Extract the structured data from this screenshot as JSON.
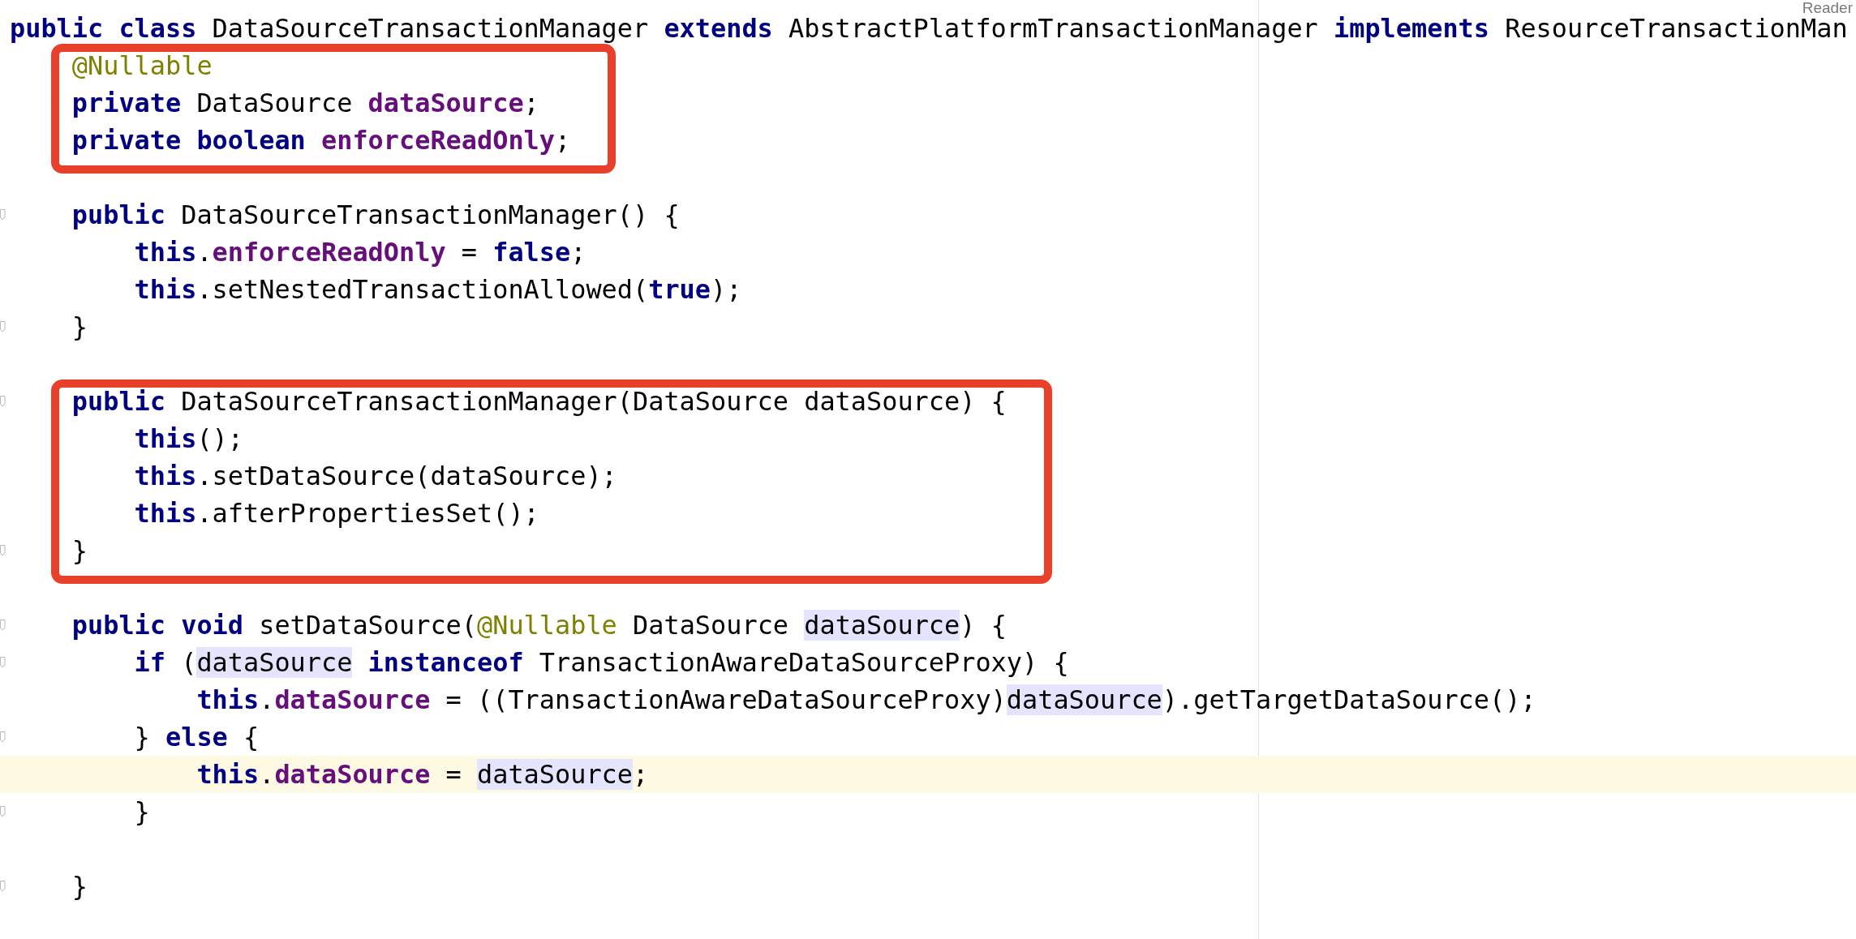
{
  "reader_label": "Reader",
  "blocks": [
    {
      "boxed": false,
      "lines": [
        {
          "current": false,
          "fold_marker": false,
          "tokens": [
            {
              "kind": "keyword",
              "text": "public ",
              "usage": false
            },
            {
              "kind": "keyword",
              "text": "class",
              "usage": false
            },
            {
              "kind": "plain",
              "text": " DataSourceTransactionManager ",
              "usage": false
            },
            {
              "kind": "keyword",
              "text": "extends",
              "usage": false
            },
            {
              "kind": "plain",
              "text": " AbstractPlatformTransactionManager ",
              "usage": false
            },
            {
              "kind": "keyword",
              "text": "implements",
              "usage": false
            },
            {
              "kind": "plain",
              "text": " ResourceTransactionMan",
              "usage": false
            }
          ]
        }
      ]
    },
    {
      "boxed": true,
      "lines": [
        {
          "current": false,
          "fold_marker": false,
          "tokens": [
            {
              "kind": "annotation",
              "text": "    @Nullable",
              "usage": false
            }
          ]
        },
        {
          "current": false,
          "fold_marker": false,
          "tokens": [
            {
              "kind": "keyword",
              "text": "    private",
              "usage": false
            },
            {
              "kind": "plain",
              "text": " DataSource ",
              "usage": false
            },
            {
              "kind": "field",
              "text": "dataSource",
              "usage": false
            },
            {
              "kind": "plain",
              "text": ";",
              "usage": false
            }
          ]
        },
        {
          "current": false,
          "fold_marker": false,
          "tokens": [
            {
              "kind": "keyword",
              "text": "    private ",
              "usage": false
            },
            {
              "kind": "keyword",
              "text": "boolean ",
              "usage": false
            },
            {
              "kind": "field",
              "text": "enforceReadOnly",
              "usage": false
            },
            {
              "kind": "plain",
              "text": ";",
              "usage": false
            }
          ]
        }
      ]
    },
    {
      "boxed": false,
      "lines": [
        {
          "current": false,
          "fold_marker": false
        },
        {
          "current": false,
          "fold_marker": true,
          "tokens": [
            {
              "kind": "keyword",
              "text": "    public",
              "usage": false
            },
            {
              "kind": "plain",
              "text": " DataSourceTransactionManager() {",
              "usage": false
            }
          ]
        },
        {
          "current": false,
          "fold_marker": false,
          "tokens": [
            {
              "kind": "keyword",
              "text": "        this",
              "usage": false
            },
            {
              "kind": "plain",
              "text": ".",
              "usage": false
            },
            {
              "kind": "field",
              "text": "enforceReadOnly",
              "usage": false
            },
            {
              "kind": "plain",
              "text": " = ",
              "usage": false
            },
            {
              "kind": "keyword",
              "text": "false",
              "usage": false
            },
            {
              "kind": "plain",
              "text": ";",
              "usage": false
            }
          ]
        },
        {
          "current": false,
          "fold_marker": false,
          "tokens": [
            {
              "kind": "keyword",
              "text": "        this",
              "usage": false
            },
            {
              "kind": "plain",
              "text": ".setNestedTransactionAllowed(",
              "usage": false
            },
            {
              "kind": "keyword",
              "text": "true",
              "usage": false
            },
            {
              "kind": "plain",
              "text": ");",
              "usage": false
            }
          ]
        },
        {
          "current": false,
          "fold_marker": true,
          "tokens": [
            {
              "kind": "plain",
              "text": "    }",
              "usage": false
            }
          ]
        },
        {
          "current": false,
          "fold_marker": false
        }
      ]
    },
    {
      "boxed": true,
      "lines": [
        {
          "current": false,
          "fold_marker": true,
          "tokens": [
            {
              "kind": "keyword",
              "text": "    public",
              "usage": false
            },
            {
              "kind": "plain",
              "text": " DataSourceTransactionManager(DataSource dataSource) {",
              "usage": false
            }
          ]
        },
        {
          "current": false,
          "fold_marker": false,
          "tokens": [
            {
              "kind": "keyword",
              "text": "        this",
              "usage": false
            },
            {
              "kind": "plain",
              "text": "();",
              "usage": false
            }
          ]
        },
        {
          "current": false,
          "fold_marker": false,
          "tokens": [
            {
              "kind": "keyword",
              "text": "        this",
              "usage": false
            },
            {
              "kind": "plain",
              "text": ".setDataSource(dataSource);",
              "usage": false
            }
          ]
        },
        {
          "current": false,
          "fold_marker": false,
          "tokens": [
            {
              "kind": "keyword",
              "text": "        this",
              "usage": false
            },
            {
              "kind": "plain",
              "text": ".afterPropertiesSet();",
              "usage": false
            }
          ]
        },
        {
          "current": false,
          "fold_marker": true,
          "tokens": [
            {
              "kind": "plain",
              "text": "    }",
              "usage": false
            }
          ]
        }
      ]
    },
    {
      "boxed": false,
      "lines": [
        {
          "current": false,
          "fold_marker": false
        },
        {
          "current": false,
          "fold_marker": true,
          "tokens": [
            {
              "kind": "keyword",
              "text": "    public ",
              "usage": false
            },
            {
              "kind": "keyword",
              "text": "void",
              "usage": false
            },
            {
              "kind": "plain",
              "text": " setDataSource(",
              "usage": false
            },
            {
              "kind": "annotation",
              "text": "@Nullable",
              "usage": false
            },
            {
              "kind": "plain",
              "text": " DataSource ",
              "usage": false
            },
            {
              "kind": "plain",
              "text": "dataSource",
              "usage": true
            },
            {
              "kind": "plain",
              "text": ") {",
              "usage": false
            }
          ]
        },
        {
          "current": false,
          "fold_marker": true,
          "tokens": [
            {
              "kind": "keyword",
              "text": "        if",
              "usage": false
            },
            {
              "kind": "plain",
              "text": " (",
              "usage": false
            },
            {
              "kind": "plain",
              "text": "dataSource",
              "usage": true
            },
            {
              "kind": "keyword",
              "text": " instanceof",
              "usage": false
            },
            {
              "kind": "plain",
              "text": " TransactionAwareDataSourceProxy) {",
              "usage": false
            }
          ]
        },
        {
          "current": false,
          "fold_marker": false,
          "tokens": [
            {
              "kind": "keyword",
              "text": "            this",
              "usage": false
            },
            {
              "kind": "plain",
              "text": ".",
              "usage": false
            },
            {
              "kind": "field",
              "text": "dataSource",
              "usage": false
            },
            {
              "kind": "plain",
              "text": " = ((TransactionAwareDataSourceProxy)",
              "usage": false
            },
            {
              "kind": "plain",
              "text": "dataSource",
              "usage": true
            },
            {
              "kind": "plain",
              "text": ").getTargetDataSource();",
              "usage": false
            }
          ]
        },
        {
          "current": false,
          "fold_marker": true,
          "tokens": [
            {
              "kind": "plain",
              "text": "        } ",
              "usage": false
            },
            {
              "kind": "keyword",
              "text": "else",
              "usage": false
            },
            {
              "kind": "plain",
              "text": " {",
              "usage": false
            }
          ]
        },
        {
          "current": true,
          "fold_marker": false,
          "tokens": [
            {
              "kind": "keyword",
              "text": "            this",
              "usage": false
            },
            {
              "kind": "plain",
              "text": ".",
              "usage": false
            },
            {
              "kind": "field",
              "text": "dataSource",
              "usage": false
            },
            {
              "kind": "plain",
              "text": " = ",
              "usage": false
            },
            {
              "kind": "plain",
              "text": "dataSource",
              "usage": true
            },
            {
              "kind": "plain",
              "text": ";",
              "usage": false
            }
          ]
        },
        {
          "current": false,
          "fold_marker": true,
          "tokens": [
            {
              "kind": "plain",
              "text": "        }",
              "usage": false
            }
          ]
        },
        {
          "current": false,
          "fold_marker": false
        },
        {
          "current": false,
          "fold_marker": true,
          "tokens": [
            {
              "kind": "plain",
              "text": "    }",
              "usage": false
            }
          ]
        }
      ]
    }
  ]
}
